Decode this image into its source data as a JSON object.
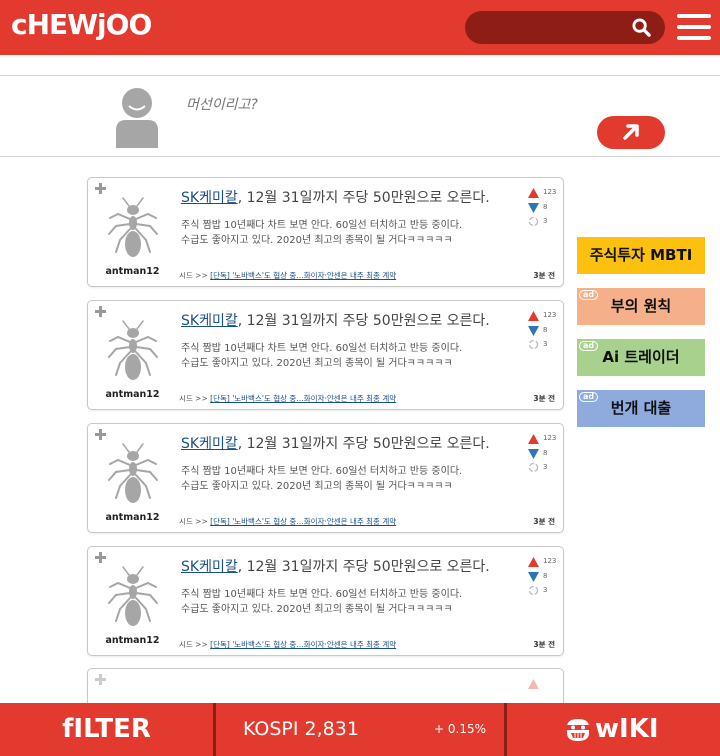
{
  "header": {
    "logo": "cHEWjOO"
  },
  "composer": {
    "placeholder": "머선이리고?"
  },
  "posts": [
    {
      "author": "antman12",
      "ticker": "SK케미칼",
      "title_rest": ", 12월 31일까지 주당 50만원으로 오른다.",
      "body_line1": "주식 짬밥 10년째다 차트 보면 안다. 60일선 터치하고 반등 중이다.",
      "body_line2": "수급도 좋아지고 있다. 2020년 최고의 종목이 될 거다ㅋㅋㅋㅋㅋ",
      "upvotes": "123",
      "downvotes": "8",
      "reposts": "3",
      "footer_prefix": "시드 >>",
      "footer_link": "[단독] '노바백스'도 협상 중…화이자·얀센은 내주 최종 계약",
      "time": "3분 전"
    },
    {
      "author": "antman12",
      "ticker": "SK케미칼",
      "title_rest": ", 12월 31일까지 주당 50만원으로 오른다.",
      "body_line1": "주식 짬밥 10년째다 차트 보면 안다. 60일선 터치하고 반등 중이다.",
      "body_line2": "수급도 좋아지고 있다. 2020년 최고의 종목이 될 거다ㅋㅋㅋㅋㅋ",
      "upvotes": "123",
      "downvotes": "8",
      "reposts": "3",
      "footer_prefix": "시드 >>",
      "footer_link": "[단독] '노바백스'도 협상 중…화이자·얀센은 내주 최종 계약",
      "time": "3분 전"
    },
    {
      "author": "antman12",
      "ticker": "SK케미칼",
      "title_rest": ", 12월 31일까지 주당 50만원으로 오른다.",
      "body_line1": "주식 짬밥 10년째다 차트 보면 안다. 60일선 터치하고 반등 중이다.",
      "body_line2": "수급도 좋아지고 있다. 2020년 최고의 종목이 될 거다ㅋㅋㅋㅋㅋ",
      "upvotes": "123",
      "downvotes": "8",
      "reposts": "3",
      "footer_prefix": "시드 >>",
      "footer_link": "[단독] '노바백스'도 협상 중…화이자·얀센은 내주 최종 계약",
      "time": "3분 전"
    },
    {
      "author": "antman12",
      "ticker": "SK케미칼",
      "title_rest": ", 12월 31일까지 주당 50만원으로 오른다.",
      "body_line1": "주식 짬밥 10년째다 차트 보면 안다. 60일선 터치하고 반등 중이다.",
      "body_line2": "수급도 좋아지고 있다. 2020년 최고의 종목이 될 거다ㅋㅋㅋㅋㅋ",
      "upvotes": "123",
      "downvotes": "8",
      "reposts": "3",
      "footer_prefix": "시드 >>",
      "footer_link": "[단독] '노바백스'도 협상 중…화이자·얀센은 내주 최종 계약",
      "time": "3분 전"
    }
  ],
  "side_buttons": [
    {
      "label": "주식투자 MBTI",
      "color": "#fcc10f",
      "ad": ""
    },
    {
      "label": "부의 원칙",
      "color": "#f5b08a",
      "ad": "ad"
    },
    {
      "label": "Ai 트레이더",
      "color": "#a9d18e",
      "ad": "ad"
    },
    {
      "label": "번개 대출",
      "color": "#8faadc",
      "ad": "ad"
    }
  ],
  "bottom_bar": {
    "filter_label": "fILTER",
    "kospi_label": "KOSPI 2,831",
    "kospi_change": "+ 0.15%",
    "wiki_label": "wIKI"
  },
  "colors": {
    "brand_red": "#e23a2e",
    "dark_red": "#8e1d16",
    "up_red": "#e23a2e",
    "down_blue": "#2e75b6",
    "icon_gray": "#a6a6a6"
  },
  "icons": {
    "search": "search-icon",
    "menu": "hamburger-menu-icon",
    "send": "arrow-up-right-icon",
    "avatar": "user-avatar-icon",
    "author": "ant-icon",
    "wiki": "mascot-face-icon"
  }
}
